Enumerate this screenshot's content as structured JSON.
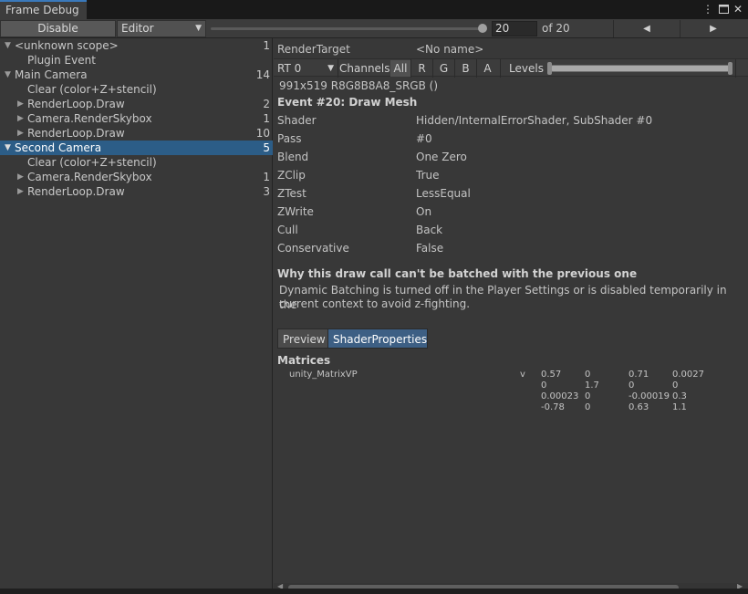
{
  "window": {
    "tab_title": "Frame Debug",
    "menu_icon": "more-vert-icon",
    "maximize_icon": "maximize-icon",
    "close_icon": "close-icon"
  },
  "toolbar": {
    "disable_label": "Disable",
    "target_dropdown": "Editor",
    "frame_current": "20",
    "frame_total_label": "of 20",
    "slider_fraction": 1.0
  },
  "tree": [
    {
      "label": "<unknown scope>",
      "count": "1",
      "expanded": true
    },
    {
      "label": "Plugin Event",
      "count": ""
    },
    {
      "label": "Main Camera",
      "count": "14",
      "expanded": true
    },
    {
      "label": "Clear (color+Z+stencil)",
      "count": ""
    },
    {
      "label": "RenderLoop.Draw",
      "count": "2",
      "collapsed": true
    },
    {
      "label": "Camera.RenderSkybox",
      "count": "1",
      "collapsed": true
    },
    {
      "label": "RenderLoop.Draw",
      "count": "10",
      "collapsed": true
    },
    {
      "label": "Second Camera",
      "count": "5",
      "expanded": true,
      "selected": true
    },
    {
      "label": "Clear (color+Z+stencil)",
      "count": ""
    },
    {
      "label": "Camera.RenderSkybox",
      "count": "1",
      "collapsed": true
    },
    {
      "label": "RenderLoop.Draw",
      "count": "3",
      "collapsed": true
    }
  ],
  "details": {
    "render_target_label": "RenderTarget",
    "render_target_value": "<No name>",
    "rt_dropdown": "RT 0",
    "channels_label": "Channels",
    "channels": [
      "All",
      "R",
      "G",
      "B",
      "A"
    ],
    "levels_label": "Levels",
    "format_text": "991x519 R8G8B8A8_SRGB ()",
    "event_title": "Event #20: Draw Mesh",
    "properties": [
      {
        "label": "Shader",
        "value": "Hidden/InternalErrorShader, SubShader #0"
      },
      {
        "label": "Pass",
        "value": "#0"
      },
      {
        "label": "Blend",
        "value": "One Zero"
      },
      {
        "label": "ZClip",
        "value": "True"
      },
      {
        "label": "ZTest",
        "value": "LessEqual"
      },
      {
        "label": "ZWrite",
        "value": "On"
      },
      {
        "label": "Cull",
        "value": "Back"
      },
      {
        "label": "Conservative",
        "value": "False"
      }
    ],
    "batch_heading": "Why this draw call can't be batched with the previous one",
    "batch_line1": "Dynamic Batching is turned off in the Player Settings or is disabled temporarily in the",
    "batch_line2": "current context to avoid z-fighting.",
    "tab_preview": "Preview",
    "tab_shader_props": "ShaderProperties",
    "matrices_heading": "Matrices",
    "matrix_name": "unity_MatrixVP",
    "matrix_stage": "v",
    "matrix_rows": [
      [
        "0.57",
        "0",
        "0.71",
        "0.0027"
      ],
      [
        "0",
        "1.7",
        "0",
        "0"
      ],
      [
        "0.00023",
        "0",
        "-0.00019",
        "0.3"
      ],
      [
        "-0.78",
        "0",
        "0.63",
        "1.1"
      ]
    ]
  }
}
